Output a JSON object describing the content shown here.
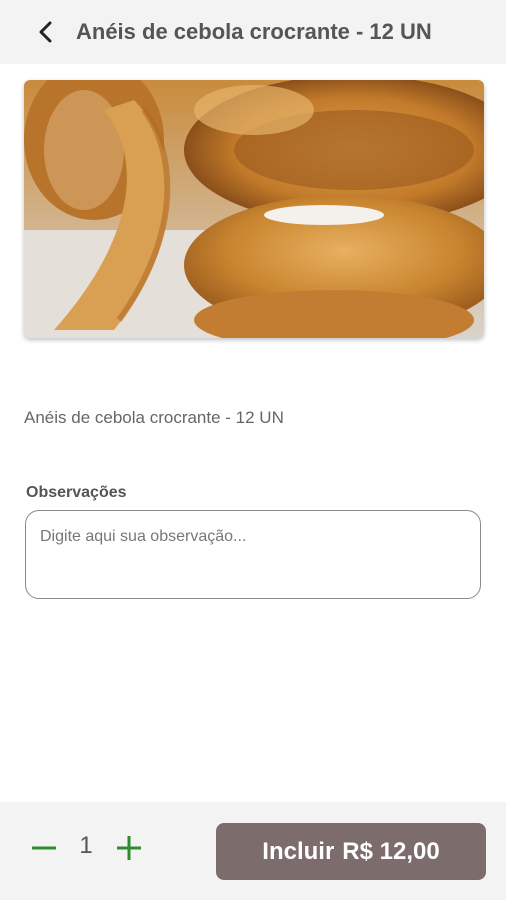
{
  "header": {
    "title": "Anéis de cebola crocrante - 12 UN",
    "back_icon": "chevron-left-icon"
  },
  "product": {
    "image_subject": "onion-rings-photo",
    "description": "Anéis de cebola crocrante - 12 UN"
  },
  "observations": {
    "label": "Observações",
    "placeholder": "Digite aqui sua observação...",
    "value": ""
  },
  "footer": {
    "quantity": "1",
    "minus_icon": "minus-icon",
    "plus_icon": "plus-icon",
    "include_label": "Incluir",
    "price": "R$ 12,00"
  },
  "colors": {
    "header_bg": "#f3f3f3",
    "accent_green": "#2e8b2e",
    "button_bg": "#7d6c6c",
    "title_text": "#555555"
  }
}
